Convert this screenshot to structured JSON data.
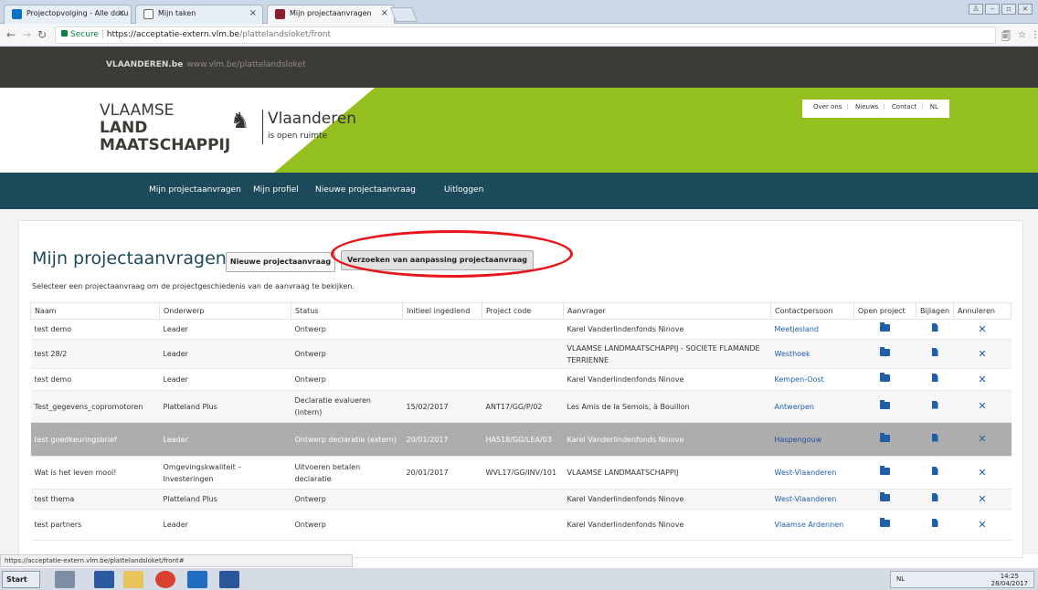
{
  "browser": {
    "tabs": [
      {
        "title": "Projectopvolging - Alle docu"
      },
      {
        "title": "Mijn taken"
      },
      {
        "title": "Mijn projectaanvragen"
      }
    ],
    "url_secure": "Secure",
    "url_host": "https://acceptatie-extern.vlm.be",
    "url_path": "/plattelandsloket/front",
    "status_url": "https://acceptatie-extern.vlm.be/plattelandsloket/front#"
  },
  "site": {
    "brand": "VLAANDEREN.be",
    "brand_url": "www.vlm.be/plattelandsloket",
    "logo_line1": "VLAAMSE",
    "logo_line2": "LAND",
    "logo_line3": "MAATSCHAPPIJ",
    "vlaanderen": "Vlaanderen",
    "vlaanderen_sub": "is open ruimte",
    "top_links": [
      "Over ons",
      "Nieuws",
      "Contact",
      "NL"
    ],
    "nav": [
      "Mijn projectaanvragen",
      "Mijn profiel",
      "Nieuwe projectaanvraag",
      "Uitloggen"
    ]
  },
  "main": {
    "title": "Mijn projectaanvragen",
    "new_button": "Nieuwe projectaanvraag",
    "requests_button": "Verzoeken van aanpassing projectaanvraag",
    "hint": "Selecteer een projectaanvraag om de projectgeschiedenis van de aanvraag te bekijken.",
    "columns": [
      "Naam",
      "Onderwerp",
      "Status",
      "Initieel ingediend",
      "Project code",
      "Aanvrager",
      "Contactpersoon",
      "Open project",
      "Bijlagen",
      "Annuleren"
    ],
    "rows": [
      {
        "naam": "test demo",
        "onderwerp": "Leader",
        "status": "Ontwerp",
        "ingediend": "",
        "code": "",
        "aanvrager": "Karel Vanderlindenfonds Ninove",
        "contact": "Meetjesland"
      },
      {
        "naam": "test 28/2",
        "onderwerp": "Leader",
        "status": "Ontwerp",
        "ingediend": "",
        "code": "",
        "aanvrager": "VLAAMSE LANDMAATSCHAPPIJ - SOCIETE FLAMANDE TERRIENNE",
        "contact": "Westhoek"
      },
      {
        "naam": "test demo",
        "onderwerp": "Leader",
        "status": "Ontwerp",
        "ingediend": "",
        "code": "",
        "aanvrager": "Karel Vanderlindenfonds Ninove",
        "contact": "Kempen-Oost"
      },
      {
        "naam": "Test_gegevens_copromotoren",
        "onderwerp": "Platteland Plus",
        "status": "Declaratie evalueren (intern)",
        "ingediend": "15/02/2017",
        "code": "ANT17/GG/P/02",
        "aanvrager": "Les Amis de la Semois, à Bouillon",
        "contact": "Antwerpen"
      },
      {
        "naam": "test goedkeuringsbrief",
        "onderwerp": "Leader",
        "status": "Ontwerp declaratie (extern)",
        "ingediend": "20/01/2017",
        "code": "HAS18/GG/LEA/03",
        "aanvrager": "Karel Vanderlindenfonds Ninove",
        "contact": "Haspengouw"
      },
      {
        "naam": "Wat is het leven mooi!",
        "onderwerp": "Omgevingskwaliteit – Investeringen",
        "status": "Uitvoeren betalen declaratie",
        "ingediend": "20/01/2017",
        "code": "WVL17/GG/INV/101",
        "aanvrager": "VLAAMSE LANDMAATSCHAPPIJ",
        "contact": "West-Vlaanderen"
      },
      {
        "naam": "test thema",
        "onderwerp": "Platteland Plus",
        "status": "Ontwerp",
        "ingediend": "",
        "code": "",
        "aanvrager": "Karel Vanderlindenfonds Ninove",
        "contact": "West-Vlaanderen"
      },
      {
        "naam": "test partners",
        "onderwerp": "Leader",
        "status": "Ontwerp",
        "ingediend": "",
        "code": "",
        "aanvrager": "Karel Vanderlindenfonds Ninove",
        "contact": "Vlaamse Ardennen"
      }
    ]
  },
  "taskbar": {
    "start": "Start",
    "lang": "NL",
    "time": "14:25",
    "date": "28/04/2017"
  },
  "colors": {
    "nav_bg": "#1d4a5b",
    "green": "#93c01f",
    "top_strip": "#3d3b35",
    "link": "#1f5fa8",
    "annotation": "#e8151b"
  }
}
